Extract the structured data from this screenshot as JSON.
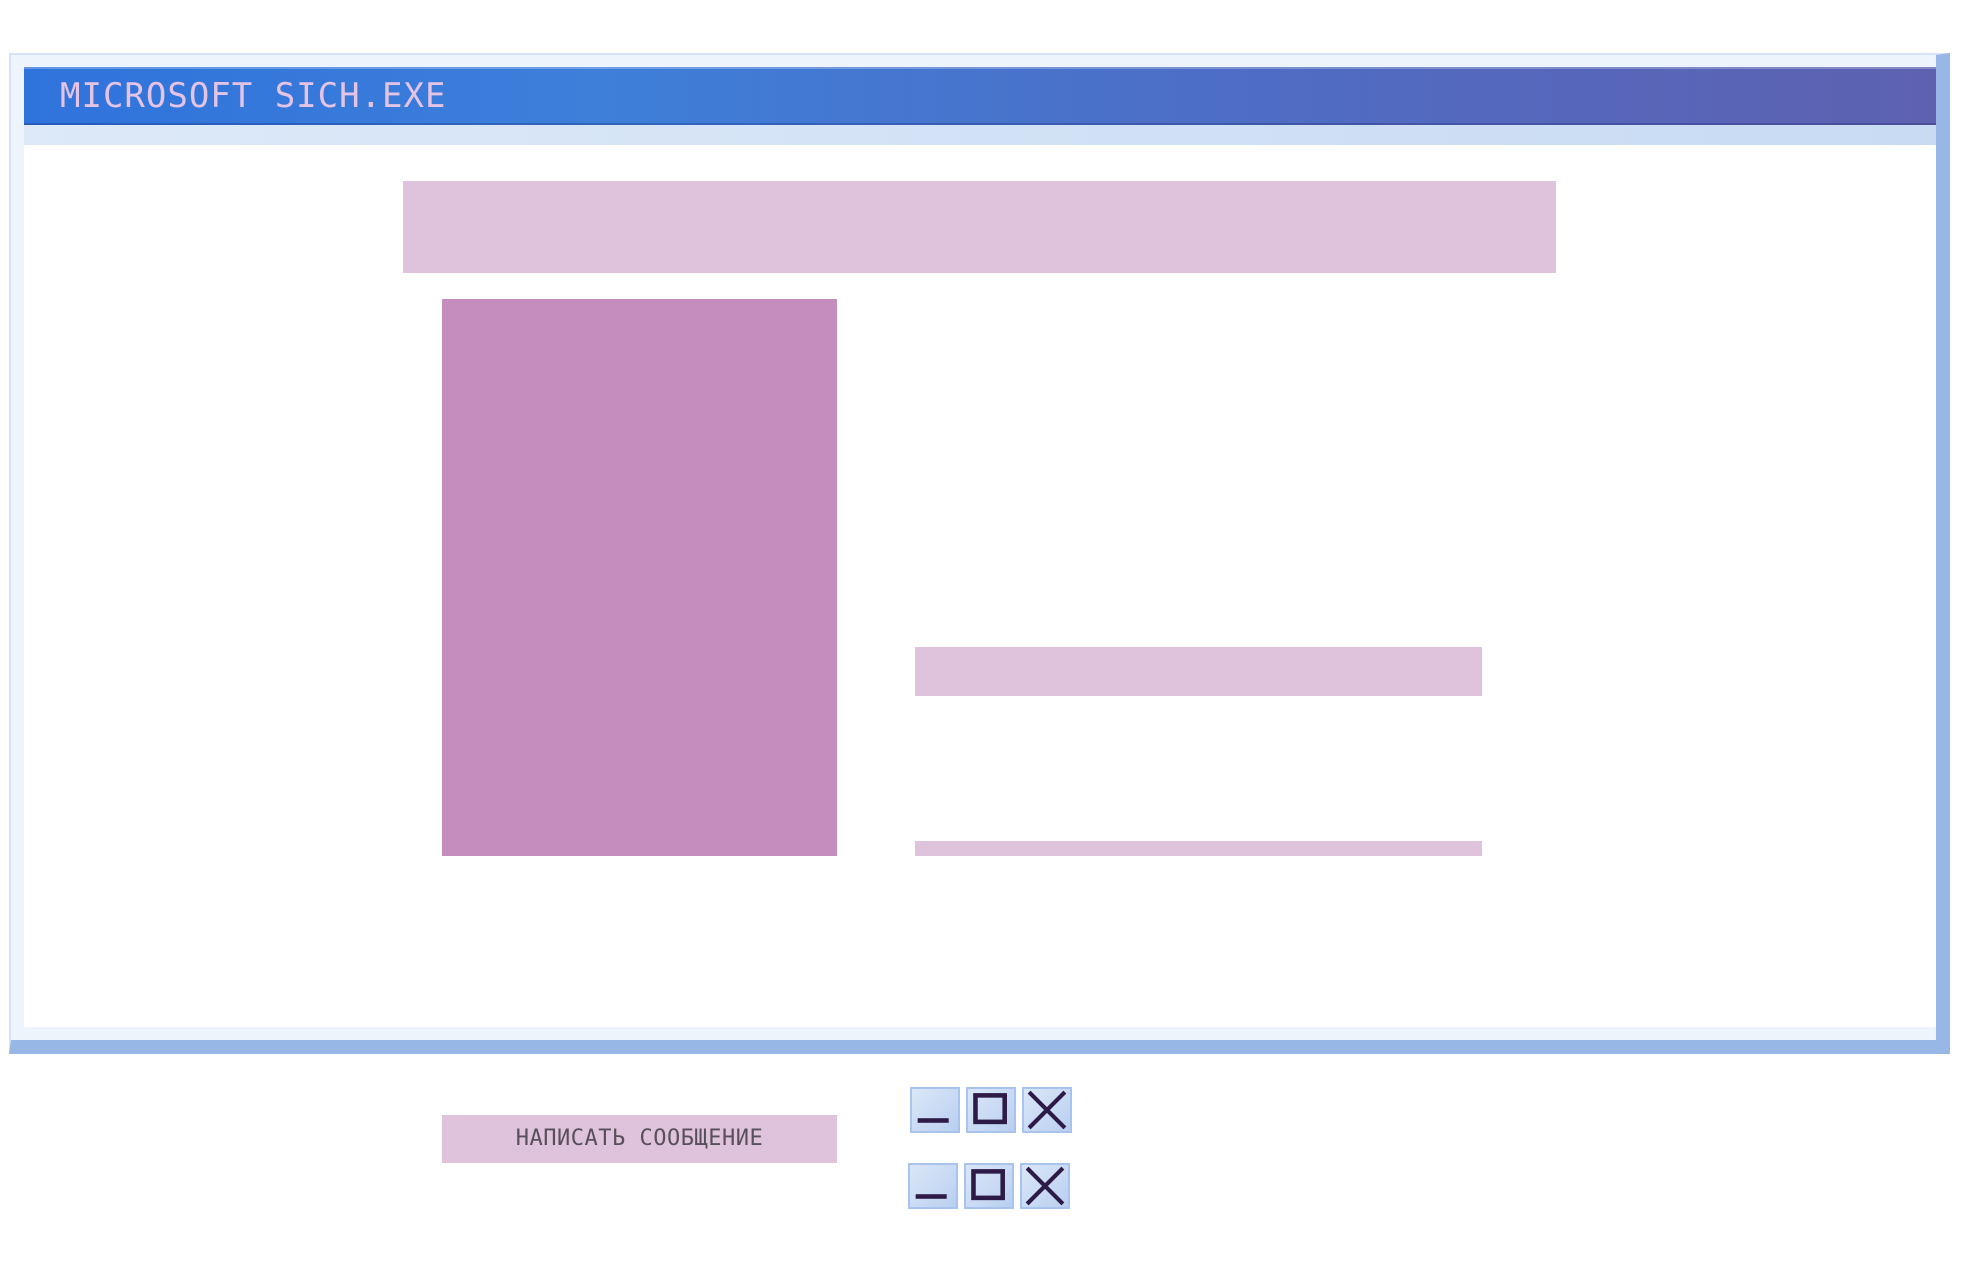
{
  "window": {
    "title": "MICROSOFT SICH.EXE",
    "accent_color": "#3d7fd9",
    "frame_color": "#97b8e6"
  },
  "content": {
    "header_placeholder_color": "#dfc2db",
    "photo_placeholder_color": "#c58cbe"
  },
  "actions": {
    "message_button_label": "НАПИСАТЬ СООБЩЕНИЕ"
  },
  "controls": {
    "groups": [
      {
        "buttons": [
          "minimize-icon",
          "maximize-icon",
          "close-icon"
        ]
      },
      {
        "buttons": [
          "minimize-icon",
          "maximize-icon",
          "close-icon"
        ]
      }
    ],
    "glyph_color": "#2e1a47"
  }
}
